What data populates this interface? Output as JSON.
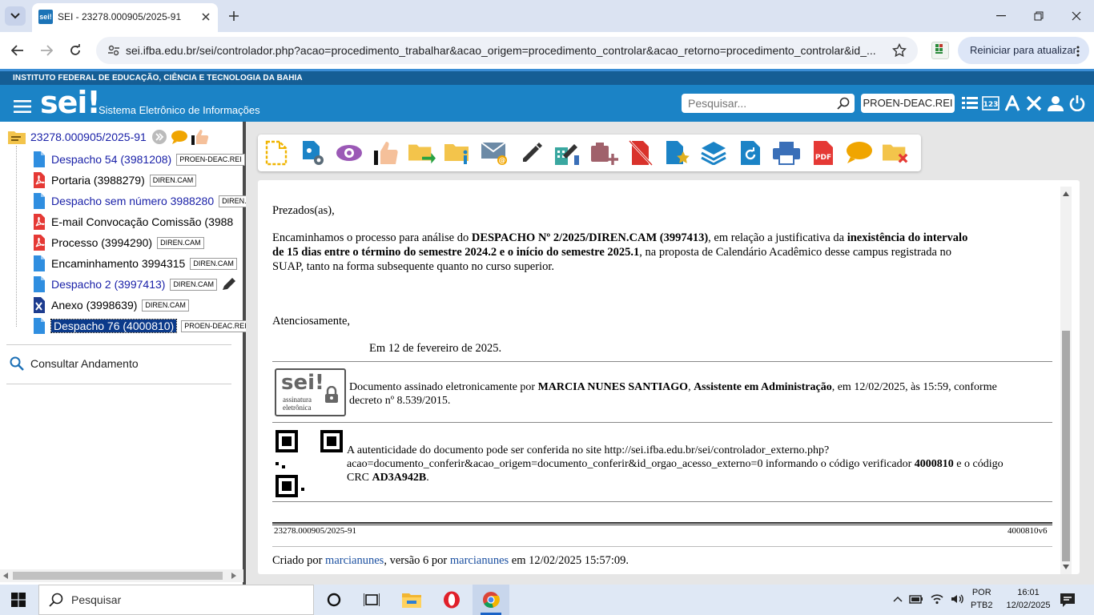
{
  "browser": {
    "tab_title": "SEI - 23278.000905/2025-91",
    "tab_favicon": "sei!",
    "url": "sei.ifba.edu.br/sei/controlador.php?acao=procedimento_trabalhar&acao_origem=procedimento_controlar&acao_retorno=procedimento_controlar&id_...",
    "restart_label": "Reiniciar para atualizar"
  },
  "header": {
    "institution": "INSTITUTO FEDERAL DE EDUCAÇÃO, CIÊNCIA E TECNOLOGIA DA BAHIA",
    "logo": "sei!",
    "system_name": "Sistema Eletrônico de Informações",
    "search_placeholder": "Pesquisar...",
    "unit": "PROEN-DEAC.REI",
    "accent": "#1b83c6"
  },
  "tree": {
    "process": "23278.000905/2025-91",
    "items": [
      {
        "label": "Despacho 54 (3981208)",
        "tag": "PROEN-DEAC.REI",
        "icon": "doc-icon",
        "color": "blue"
      },
      {
        "label": "Portaria (3988279)",
        "tag": "DIREN.CAM",
        "icon": "pdf-icon",
        "color": "black"
      },
      {
        "label": "Despacho sem número 3988280",
        "tag": "DIREN.CAM",
        "icon": "doc-icon",
        "color": "blue"
      },
      {
        "label": "E-mail Convocação Comissão (3988",
        "tag": "",
        "icon": "pdf-icon",
        "color": "black"
      },
      {
        "label": "Processo (3994290)",
        "tag": "DIREN.CAM",
        "icon": "pdf-icon",
        "color": "black"
      },
      {
        "label": "Encaminhamento 3994315",
        "tag": "DIREN.CAM",
        "icon": "doc-icon",
        "color": "black"
      },
      {
        "label": "Despacho 2 (3997413)",
        "tag": "DIREN.CAM",
        "icon": "doc-icon",
        "color": "blue"
      },
      {
        "label": "Anexo (3998639)",
        "tag": "DIREN.CAM",
        "icon": "excel-icon",
        "color": "black"
      },
      {
        "label": "Despacho 76 (4000810)",
        "tag": "PROEN-DEAC.REI",
        "icon": "doc-icon",
        "color": "selected"
      }
    ],
    "consultar": "Consultar Andamento"
  },
  "document": {
    "greeting": "Prezados(as),",
    "body_line1_a": "Encaminhamos o processo para análise do ",
    "body_line1_b": "DESPACHO Nº 2/2025/DIREN.CAM (3997413)",
    "body_line1_c": ", em relação a justificativa da ",
    "body_line1_d": "inexistência do intervalo",
    "body_line2_a": "de 15 dias entre o término do semestre 2024.2 e o início do semestre 2025.1",
    "body_line2_b": ", na proposta de Calendário Acadêmico desse campus registrada no",
    "body_line3": "SUAP, tanto na forma subsequente quanto no curso superior.",
    "closing": "Atenciosamente,",
    "date": "Em 12 de fevereiro de 2025.",
    "seal_logo": "sei!",
    "seal_sub1": "assinatura",
    "seal_sub2": "eletrônica",
    "sig_a": "Documento assinado eletronicamente por ",
    "sig_name": "MARCIA NUNES SANTIAGO",
    "sig_b": ", ",
    "sig_role": "Assistente em Administração",
    "sig_c": ", em 12/02/2025, às 15:59, conforme",
    "sig_line2": "decreto nº 8.539/2015.",
    "auth_line1": "A autenticidade do documento pode ser conferida no site http://sei.ifba.edu.br/sei/controlador_externo.php?",
    "auth_line2_a": "acao=documento_conferir&acao_origem=documento_conferir&id_orgao_acesso_externo=0 informando o código verificador ",
    "auth_code": "4000810",
    "auth_line2_b": " e o código",
    "auth_line3_a": "CRC ",
    "auth_crc": "AD3A942B",
    "auth_line3_b": ".",
    "footer_left": "23278.000905/2025-91",
    "footer_right": "4000810v6",
    "created_a": "Criado por ",
    "created_user1": "marcianunes",
    "created_b": ", versão 6 por ",
    "created_user2": "marcianunes",
    "created_c": " em 12/02/2025 15:57:09."
  },
  "taskbar": {
    "search": "Pesquisar",
    "lang1": "POR",
    "lang2": "PTB2",
    "time": "16:01",
    "date": "12/02/2025"
  }
}
